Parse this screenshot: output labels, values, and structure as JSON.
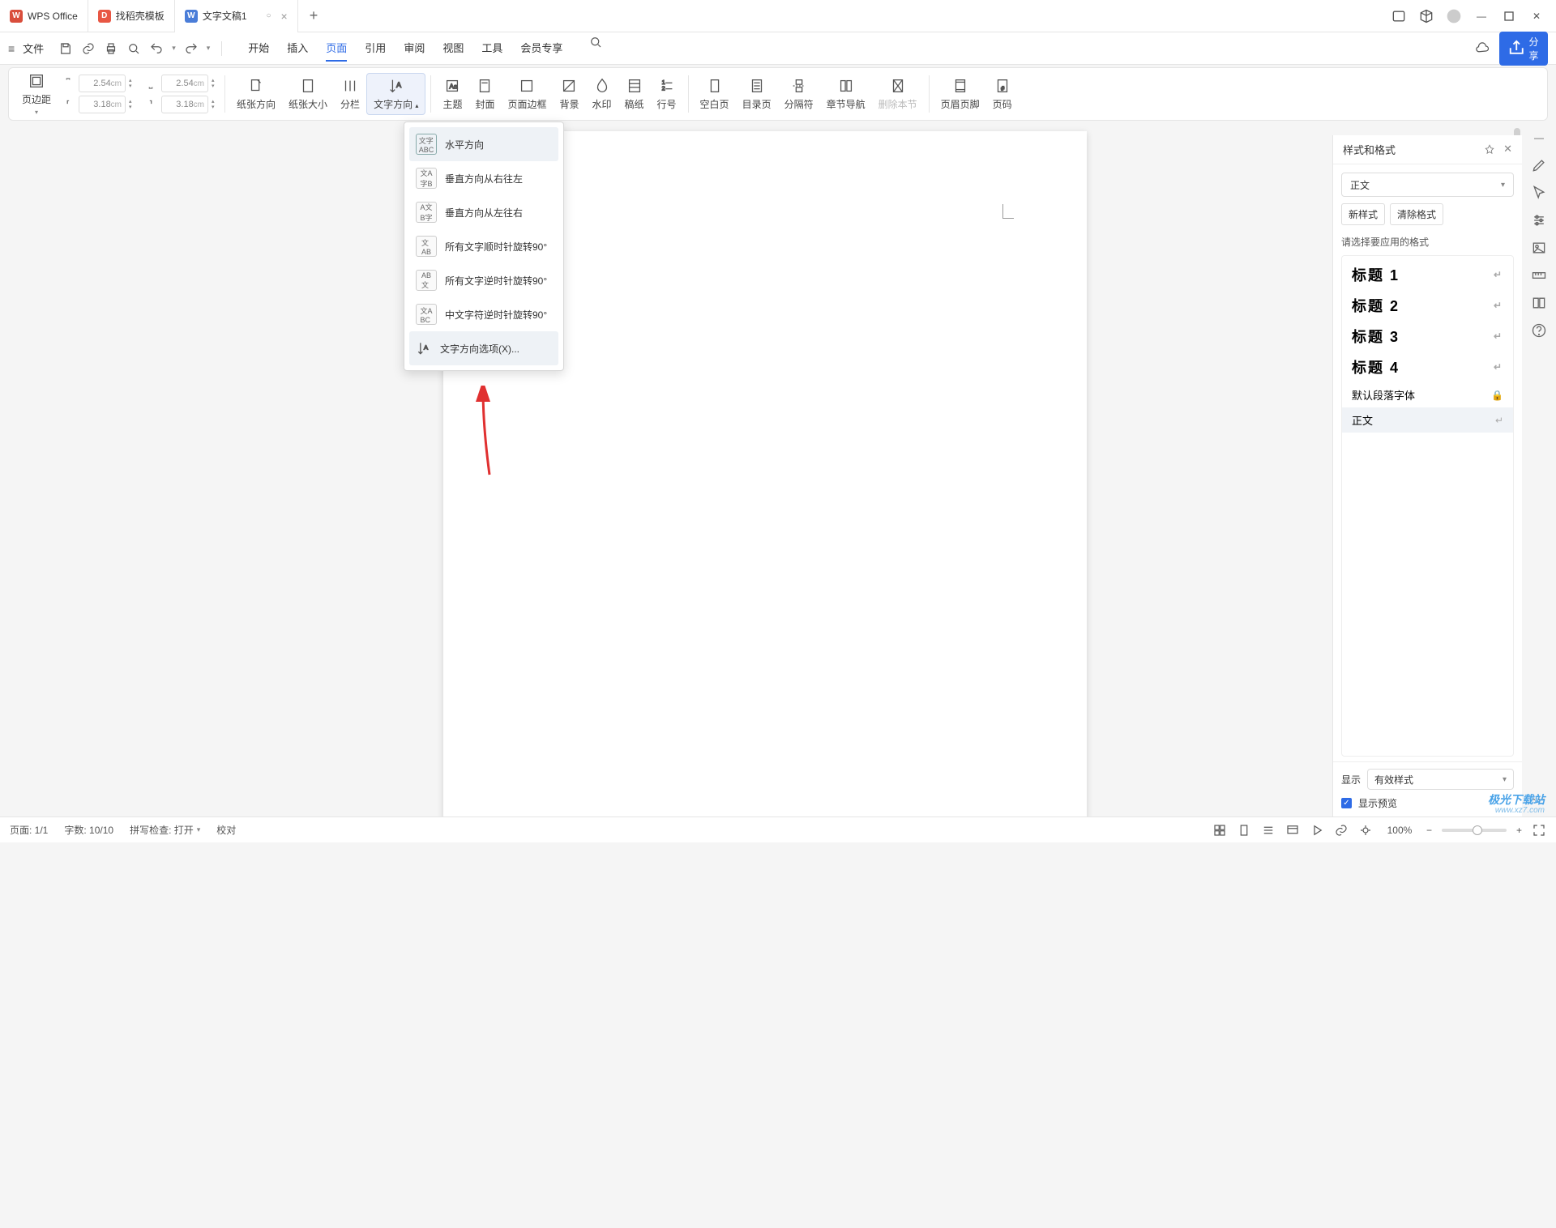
{
  "titlebar": {
    "tabs": [
      {
        "label": "WPS Office",
        "icon": "wps"
      },
      {
        "label": "找稻壳模板",
        "icon": "docer"
      },
      {
        "label": "文字文稿1",
        "icon": "word",
        "active": true
      }
    ],
    "add": "+"
  },
  "menubar": {
    "file": "文件",
    "tabs": [
      "开始",
      "插入",
      "页面",
      "引用",
      "审阅",
      "视图",
      "工具",
      "会员专享"
    ],
    "active": "页面",
    "share": "分享"
  },
  "ribbon": {
    "page_margin": "页边距",
    "margins": {
      "top": "2.54",
      "bottom": "2.54",
      "left": "3.18",
      "right": "3.18"
    },
    "orientation": "纸张方向",
    "size": "纸张大小",
    "columns": "分栏",
    "text_direction": "文字方向",
    "theme": "主题",
    "cover": "封面",
    "border": "页面边框",
    "background": "背景",
    "watermark": "水印",
    "lined_paper": "稿纸",
    "line_number": "行号",
    "blank_page": "空白页",
    "toc": "目录页",
    "separator": "分隔符",
    "chapter_nav": "章节导航",
    "delete_section": "删除本节",
    "header_footer": "页眉页脚",
    "page_number": "页码"
  },
  "dropdown": {
    "items": [
      "水平方向",
      "垂直方向从右往左",
      "垂直方向从左往右",
      "所有文字顺时针旋转90°",
      "所有文字逆时针旋转90°",
      "中文字符逆时针旋转90°",
      "文字方向选项(X)..."
    ]
  },
  "panel": {
    "title": "样式和格式",
    "current": "正文",
    "btn_new": "新样式",
    "btn_clear": "清除格式",
    "hint": "请选择要应用的格式",
    "styles": [
      {
        "label": "标题 1",
        "big": true
      },
      {
        "label": "标题 2",
        "big": true
      },
      {
        "label": "标题 3",
        "big": true
      },
      {
        "label": "标题 4",
        "big": true
      },
      {
        "label": "默认段落字体",
        "big": false,
        "locked": true
      },
      {
        "label": "正文",
        "big": false,
        "selected": true
      }
    ],
    "show_label": "显示",
    "show_value": "有效样式",
    "preview": "显示预览"
  },
  "statusbar": {
    "page": "页面: 1/1",
    "words": "字数: 10/10",
    "spell": "拼写检查: 打开",
    "proof": "校对",
    "zoom": "100%"
  },
  "watermark": {
    "line1": "极光下载站",
    "line2": "www.xz7.com"
  }
}
